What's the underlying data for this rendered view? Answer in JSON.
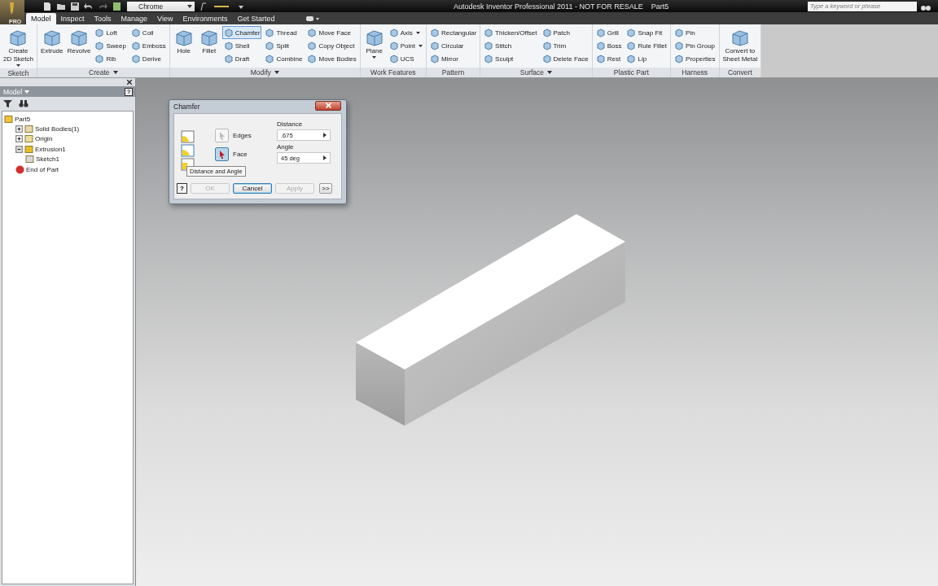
{
  "title_bar": {
    "app_badge": "PRO",
    "style_dropdown": "Chrome",
    "title": "Autodesk Inventor Professional 2011 - NOT FOR RESALE",
    "document": "Part5",
    "search": {
      "placeholder": "Type a keyword or phrase"
    }
  },
  "tabs": [
    {
      "label": "Model",
      "selected": true
    },
    {
      "label": "Inspect",
      "selected": false
    },
    {
      "label": "Tools",
      "selected": false
    },
    {
      "label": "Manage",
      "selected": false
    },
    {
      "label": "View",
      "selected": false
    },
    {
      "label": "Environments",
      "selected": false
    },
    {
      "label": "Get Started",
      "selected": false
    }
  ],
  "ribbon": [
    {
      "label": "Sketch",
      "menu": false,
      "tools": [
        {
          "label": "Create\n2D Sketch",
          "kind": "large",
          "menu": true,
          "selected": false
        }
      ]
    },
    {
      "label": "Create",
      "menu": true,
      "tools": [
        {
          "label": "Extrude",
          "kind": "large",
          "menu": false,
          "selected": false
        },
        {
          "label": "Revolve",
          "kind": "large",
          "menu": false,
          "selected": false
        },
        {
          "label": "Loft",
          "kind": "small",
          "menu": false,
          "selected": false
        },
        {
          "label": "Sweep",
          "kind": "small",
          "menu": false,
          "selected": false
        },
        {
          "label": "Rib",
          "kind": "small",
          "menu": false,
          "selected": false
        },
        {
          "label": "Coil",
          "kind": "small",
          "menu": false,
          "selected": false
        },
        {
          "label": "Emboss",
          "kind": "small",
          "menu": false,
          "selected": false
        },
        {
          "label": "Derive",
          "kind": "small",
          "menu": false,
          "selected": false
        }
      ]
    },
    {
      "label": "Modify",
      "menu": true,
      "tools": [
        {
          "label": "Hole",
          "kind": "large",
          "menu": false,
          "selected": false
        },
        {
          "label": "Fillet",
          "kind": "large",
          "menu": false,
          "selected": false
        },
        {
          "label": "Chamfer",
          "kind": "small",
          "menu": false,
          "selected": true
        },
        {
          "label": "Shell",
          "kind": "small",
          "menu": false,
          "selected": false
        },
        {
          "label": "Draft",
          "kind": "small",
          "menu": false,
          "selected": false
        },
        {
          "label": "Thread",
          "kind": "small",
          "menu": false,
          "selected": false
        },
        {
          "label": "Split",
          "kind": "small",
          "menu": false,
          "selected": false
        },
        {
          "label": "Combine",
          "kind": "small",
          "menu": false,
          "selected": false
        },
        {
          "label": "Move Face",
          "kind": "small",
          "menu": false,
          "selected": false
        },
        {
          "label": "Copy Object",
          "kind": "small",
          "menu": false,
          "selected": false
        },
        {
          "label": "Move Bodies",
          "kind": "small",
          "menu": false,
          "selected": false
        }
      ]
    },
    {
      "label": "Work Features",
      "menu": false,
      "tools": [
        {
          "label": "Plane",
          "kind": "large",
          "menu": true,
          "selected": false
        },
        {
          "label": "Axis",
          "kind": "small",
          "menu": true,
          "selected": false
        },
        {
          "label": "Point",
          "kind": "small",
          "menu": true,
          "selected": false
        },
        {
          "label": "UCS",
          "kind": "small",
          "menu": false,
          "selected": false
        }
      ]
    },
    {
      "label": "Pattern",
      "menu": false,
      "tools": [
        {
          "label": "Rectangular",
          "kind": "small",
          "menu": false,
          "selected": false
        },
        {
          "label": "Circular",
          "kind": "small",
          "menu": false,
          "selected": false
        },
        {
          "label": "Mirror",
          "kind": "small",
          "menu": false,
          "selected": false
        }
      ]
    },
    {
      "label": "Surface",
      "menu": true,
      "tools": [
        {
          "label": "Thicken/Offset",
          "kind": "small",
          "menu": false,
          "selected": false
        },
        {
          "label": "Stitch",
          "kind": "small",
          "menu": false,
          "selected": false
        },
        {
          "label": "Sculpt",
          "kind": "small",
          "menu": false,
          "selected": false
        },
        {
          "label": "Patch",
          "kind": "small",
          "menu": false,
          "selected": false
        },
        {
          "label": "Trim",
          "kind": "small",
          "menu": false,
          "selected": false
        },
        {
          "label": "Delete Face",
          "kind": "small",
          "menu": false,
          "selected": false
        }
      ]
    },
    {
      "label": "Plastic Part",
      "menu": false,
      "tools": [
        {
          "label": "Grill",
          "kind": "small",
          "menu": false,
          "selected": false
        },
        {
          "label": "Boss",
          "kind": "small",
          "menu": false,
          "selected": false
        },
        {
          "label": "Rest",
          "kind": "small",
          "menu": false,
          "selected": false
        },
        {
          "label": "Snap Fit",
          "kind": "small",
          "menu": false,
          "selected": false
        },
        {
          "label": "Rule Fillet",
          "kind": "small",
          "menu": false,
          "selected": false
        },
        {
          "label": "Lip",
          "kind": "small",
          "menu": false,
          "selected": false
        }
      ]
    },
    {
      "label": "Harness",
      "menu": false,
      "tools": [
        {
          "label": "Pin",
          "kind": "small",
          "menu": false,
          "selected": false
        },
        {
          "label": "Pin Group",
          "kind": "small",
          "menu": false,
          "selected": false
        },
        {
          "label": "Properties",
          "kind": "small",
          "menu": false,
          "selected": false
        }
      ]
    },
    {
      "label": "Convert",
      "menu": false,
      "tools": [
        {
          "label": "Convert to\nSheet Metal",
          "kind": "large",
          "menu": false,
          "selected": false
        }
      ]
    }
  ],
  "browser": {
    "title": "Model",
    "tree": [
      {
        "label": "Part5",
        "kind": "part",
        "children": [
          {
            "label": "Solid Bodies(1)",
            "kind": "bodies",
            "expanded": false
          },
          {
            "label": "Origin",
            "kind": "folder",
            "expanded": false
          },
          {
            "label": "Extrusion1",
            "kind": "extrusion",
            "expanded": true,
            "children": [
              {
                "label": "Sketch1",
                "kind": "sketch"
              }
            ]
          },
          {
            "label": "End of Part",
            "kind": "end"
          }
        ]
      }
    ]
  },
  "dialog": {
    "title": "Chamfer",
    "selectors": [
      {
        "label": "Edges",
        "selected": false
      },
      {
        "label": "Face",
        "selected": true
      }
    ],
    "fields": [
      {
        "label": "Distance",
        "value": ".675"
      },
      {
        "label": "Angle",
        "value": "45 deg"
      }
    ],
    "tooltip": "Distance and Angle",
    "help": "?",
    "buttons": [
      {
        "label": "OK",
        "disabled": true,
        "focused": false
      },
      {
        "label": "Cancel",
        "disabled": false,
        "focused": true
      },
      {
        "label": "Apply",
        "disabled": true,
        "focused": false
      },
      {
        "label": ">>",
        "disabled": false,
        "focused": false
      }
    ]
  }
}
